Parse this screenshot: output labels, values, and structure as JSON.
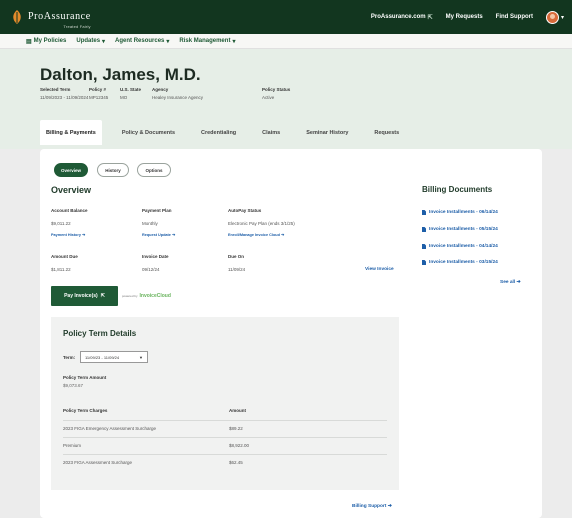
{
  "brand": {
    "name": "ProAssurance",
    "subtitle": "Treated Fairly"
  },
  "top_links": [
    {
      "label": "ProAssurance.com",
      "icon": "external-link-icon"
    },
    {
      "label": "My Requests"
    },
    {
      "label": "Find Support"
    }
  ],
  "nav": [
    {
      "label": "My Policies",
      "icon": "policy-icon"
    },
    {
      "label": "Updates",
      "caret": "▾"
    },
    {
      "label": "Agent Resources",
      "caret": "▾"
    },
    {
      "label": "Risk Management",
      "caret": "▾"
    }
  ],
  "header": {
    "name": "Dalton, James, M.D.",
    "fields": [
      {
        "label": "Selected Term",
        "value": "11/09/2023 - 11/09/2024"
      },
      {
        "label": "Policy #",
        "value": "MP12345"
      },
      {
        "label": "U.S. State",
        "value": "MO"
      },
      {
        "label": "Agency",
        "value": "Healey Insurance Agency"
      },
      {
        "label": "Policy Status",
        "value": "Active"
      }
    ]
  },
  "tabs": [
    "Billing & Payments",
    "Policy & Documents",
    "Credentialing",
    "Claims",
    "Seminar History",
    "Requests"
  ],
  "active_tab": "Billing & Payments",
  "subtabs": [
    "Overview",
    "History",
    "Options"
  ],
  "overview": {
    "title": "Overview",
    "account_balance": {
      "label": "Account Balance",
      "value": "$9,011.22",
      "link": "Payment History ➔"
    },
    "payment_plan": {
      "label": "Payment Plan",
      "value": "Monthly",
      "link": "Request Update ➔"
    },
    "autopay": {
      "label": "AutoPay Status",
      "value": "Electronic Pay Plan (ends 3/1/25)",
      "link": "Enroll/Manage Invoice Cloud ➔"
    },
    "amount_due": {
      "label": "Amount Due",
      "value": "$1,811.22"
    },
    "invoice_date": {
      "label": "Invoice Date",
      "value": "09/12/24"
    },
    "due_on": {
      "label": "Due On",
      "value": "11/09/24"
    },
    "view_invoice": "View Invoice",
    "pay_button": "Pay Invoice(s)",
    "powered_by": "powered by",
    "powered_brand": "InvoiceCloud"
  },
  "billing_documents": {
    "title": "Billing Documents",
    "items": [
      "Invoice Installments - 06/14/24",
      "Invoice Installments - 05/15/24",
      "Invoice Installments - 04/14/24",
      "Invoice Installments - 03/15/24"
    ],
    "see_all": "See all ➔"
  },
  "policy_term": {
    "title": "Policy Term Details",
    "term_label": "Term:",
    "term_value": "11/09/23 - 11/09/24",
    "amount_label": "Policy Term Amount",
    "amount_value": "$9,073.67",
    "charges_header": "Policy Term Charges",
    "amount_header": "Amount",
    "charges": [
      {
        "name": "2023 FIGA Emergency Assessment Surcharge",
        "amount": "$89.22"
      },
      {
        "name": "Premium",
        "amount": "$8,922.00"
      },
      {
        "name": "2023 FIGA Assessment Surcharge",
        "amount": "$62.45"
      }
    ]
  },
  "billing_support": "Billing Support ➔"
}
